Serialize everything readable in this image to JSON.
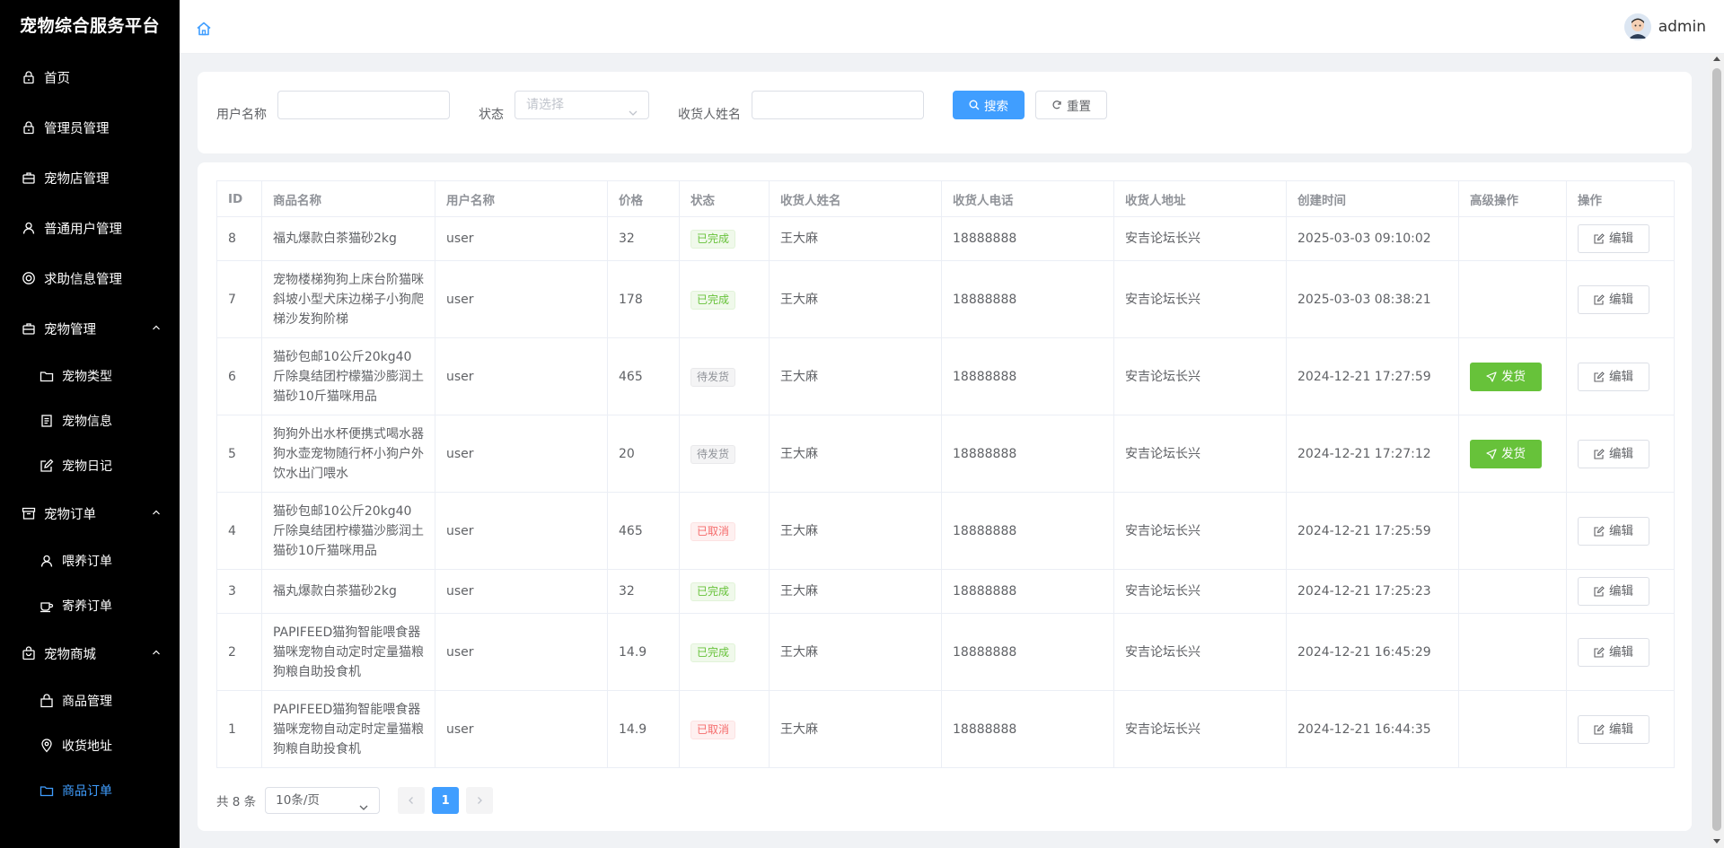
{
  "app": {
    "title": "宠物综合服务平台"
  },
  "user": {
    "name": "admin"
  },
  "sidebar": {
    "items": [
      {
        "label": "首页",
        "icon": "lock-icon"
      },
      {
        "label": "管理员管理",
        "icon": "lock-icon"
      },
      {
        "label": "宠物店管理",
        "icon": "briefcase-icon"
      },
      {
        "label": "普通用户管理",
        "icon": "user-icon"
      },
      {
        "label": "求助信息管理",
        "icon": "help-circle-icon"
      },
      {
        "label": "宠物管理",
        "icon": "briefcase-icon",
        "expanded": true,
        "children": [
          {
            "label": "宠物类型",
            "icon": "folder-icon"
          },
          {
            "label": "宠物信息",
            "icon": "document-icon"
          },
          {
            "label": "宠物日记",
            "icon": "edit-icon"
          }
        ]
      },
      {
        "label": "宠物订单",
        "icon": "box-icon",
        "expanded": true,
        "children": [
          {
            "label": "喂养订单",
            "icon": "user-icon"
          },
          {
            "label": "寄养订单",
            "icon": "cup-icon"
          }
        ]
      },
      {
        "label": "宠物商城",
        "icon": "shopping-bag-icon",
        "expanded": true,
        "children": [
          {
            "label": "商品管理",
            "icon": "bag-icon"
          },
          {
            "label": "收货地址",
            "icon": "location-icon"
          },
          {
            "label": "商品订单",
            "icon": "folder-icon",
            "active": true
          }
        ]
      }
    ]
  },
  "search": {
    "username_label": "用户名称",
    "username_value": "",
    "status_label": "状态",
    "status_placeholder": "请选择",
    "receiver_label": "收货人姓名",
    "receiver_value": "",
    "search_button": "搜索",
    "reset_button": "重置"
  },
  "table": {
    "columns": [
      "ID",
      "商品名称",
      "用户名称",
      "价格",
      "状态",
      "收货人姓名",
      "收货人电话",
      "收货人地址",
      "创建时间",
      "高级操作",
      "操作"
    ],
    "rows": [
      {
        "id": "8",
        "product": "福丸爆款白茶猫砂2kg",
        "user": "user",
        "price": "32",
        "status": "已完成",
        "status_type": "success",
        "receiver": "王大麻",
        "phone": "18888888",
        "address": "安吉论坛长兴",
        "created": "2025-03-03 09:10:02",
        "ship": "",
        "edit": "编辑"
      },
      {
        "id": "7",
        "product": "宠物楼梯狗狗上床台阶猫咪斜坡小型犬床边梯子小狗爬梯沙发狗阶梯",
        "user": "user",
        "price": "178",
        "status": "已完成",
        "status_type": "success",
        "receiver": "王大麻",
        "phone": "18888888",
        "address": "安吉论坛长兴",
        "created": "2025-03-03 08:38:21",
        "ship": "",
        "edit": "编辑"
      },
      {
        "id": "6",
        "product": "猫砂包邮10公斤20kg40斤除臭结团柠檬猫沙膨润土猫砂10斤猫咪用品",
        "user": "user",
        "price": "465",
        "status": "待发货",
        "status_type": "info",
        "receiver": "王大麻",
        "phone": "18888888",
        "address": "安吉论坛长兴",
        "created": "2024-12-21 17:27:59",
        "ship": "发货",
        "edit": "编辑"
      },
      {
        "id": "5",
        "product": "狗狗外出水杯便携式喝水器狗水壶宠物随行杯小狗户外饮水出门喂水",
        "user": "user",
        "price": "20",
        "status": "待发货",
        "status_type": "info",
        "receiver": "王大麻",
        "phone": "18888888",
        "address": "安吉论坛长兴",
        "created": "2024-12-21 17:27:12",
        "ship": "发货",
        "edit": "编辑"
      },
      {
        "id": "4",
        "product": "猫砂包邮10公斤20kg40斤除臭结团柠檬猫沙膨润土猫砂10斤猫咪用品",
        "user": "user",
        "price": "465",
        "status": "已取消",
        "status_type": "danger",
        "receiver": "王大麻",
        "phone": "18888888",
        "address": "安吉论坛长兴",
        "created": "2024-12-21 17:25:59",
        "ship": "",
        "edit": "编辑"
      },
      {
        "id": "3",
        "product": "福丸爆款白茶猫砂2kg",
        "user": "user",
        "price": "32",
        "status": "已完成",
        "status_type": "success",
        "receiver": "王大麻",
        "phone": "18888888",
        "address": "安吉论坛长兴",
        "created": "2024-12-21 17:25:23",
        "ship": "",
        "edit": "编辑"
      },
      {
        "id": "2",
        "product": "PAPIFEED猫狗智能喂食器猫咪宠物自动定时定量猫粮狗粮自助投食机",
        "user": "user",
        "price": "14.9",
        "status": "已完成",
        "status_type": "success",
        "receiver": "王大麻",
        "phone": "18888888",
        "address": "安吉论坛长兴",
        "created": "2024-12-21 16:45:29",
        "ship": "",
        "edit": "编辑"
      },
      {
        "id": "1",
        "product": "PAPIFEED猫狗智能喂食器猫咪宠物自动定时定量猫粮狗粮自助投食机",
        "user": "user",
        "price": "14.9",
        "status": "已取消",
        "status_type": "danger",
        "receiver": "王大麻",
        "phone": "18888888",
        "address": "安吉论坛长兴",
        "created": "2024-12-21 16:44:35",
        "ship": "",
        "edit": "编辑"
      }
    ]
  },
  "pagination": {
    "total_text": "共 8 条",
    "page_size": "10条/页",
    "current_page": "1"
  },
  "colors": {
    "primary": "#409eff",
    "success": "#67c23a",
    "danger": "#f56c6c",
    "sidebar_bg": "#000000"
  }
}
